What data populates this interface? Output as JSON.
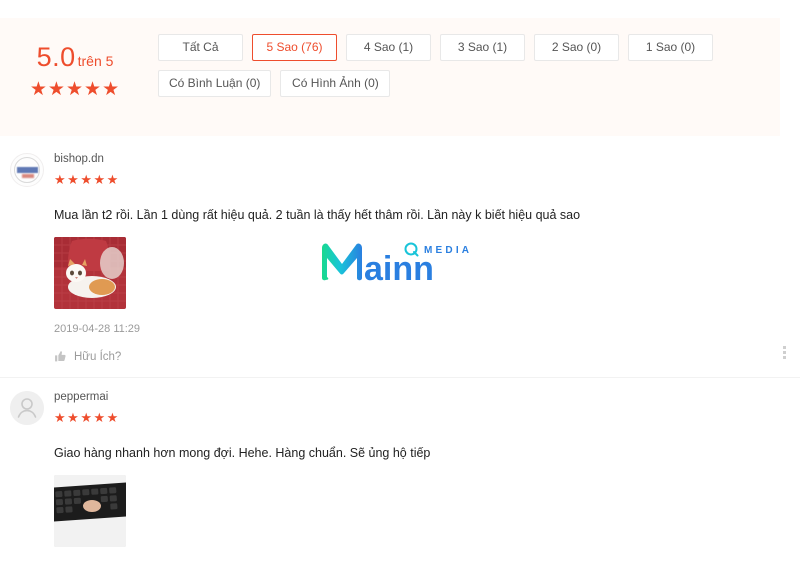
{
  "summary": {
    "score": "5.0",
    "out_of": "trên 5",
    "stars_filled": 5,
    "star_glyph": "★"
  },
  "filters": {
    "row1": [
      {
        "label": "Tất Cả",
        "active": false,
        "name": "filter-all"
      },
      {
        "label": "5 Sao (76)",
        "active": true,
        "name": "filter-5-star"
      },
      {
        "label": "4 Sao (1)",
        "active": false,
        "name": "filter-4-star"
      },
      {
        "label": "3 Sao (1)",
        "active": false,
        "name": "filter-3-star"
      },
      {
        "label": "2 Sao (0)",
        "active": false,
        "name": "filter-2-star"
      },
      {
        "label": "1 Sao (0)",
        "active": false,
        "name": "filter-1-star"
      }
    ],
    "row2": [
      {
        "label": "Có Bình Luận (0)",
        "active": false,
        "name": "filter-with-comment"
      },
      {
        "label": "Có Hình Ảnh (0)",
        "active": false,
        "name": "filter-with-image"
      }
    ]
  },
  "reviews": [
    {
      "name": "bishop.dn",
      "stars": 5,
      "text": "Mua lần t2 rồi. Lần 1 dùng rất hiệu quả. 2 tuần là thấy hết thâm rồi. Lần này k biết hiệu quả sao",
      "time": "2019-04-28 11:29",
      "helpful_label": "Hữu Ích?",
      "avatar_type": "shop-logo",
      "photo_alt": "cat-on-red-chair"
    },
    {
      "name": "peppermai",
      "stars": 5,
      "text": "Giao hàng nhanh hơn mong đợi. Hehe. Hàng chuẩn. Sẽ ủng hộ tiếp",
      "time": "",
      "helpful_label": "",
      "avatar_type": "default-person",
      "photo_alt": "black-keyboard"
    }
  ],
  "watermark": {
    "brand": "ainn",
    "suffix": "MEDIA",
    "mark": "M"
  },
  "colors": {
    "accent": "#ee4d2d",
    "header_bg": "#fffaf7",
    "star": "#ee4d2d",
    "muted_text": "#9b9b9b",
    "wm_blue": "#1f7fd8",
    "wm_green": "#1ed39a"
  }
}
